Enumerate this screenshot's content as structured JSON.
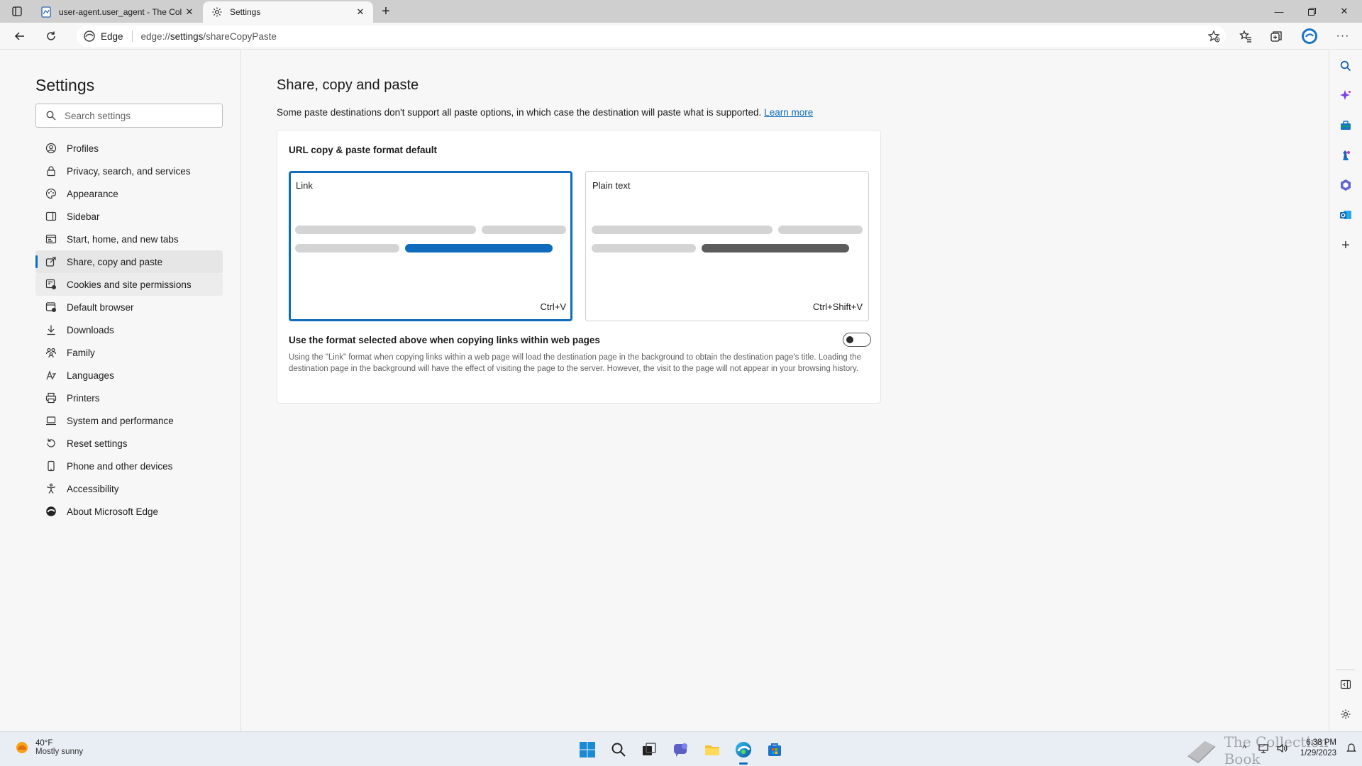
{
  "browser": {
    "tabs": [
      {
        "title": "user-agent.user_agent - The Coll",
        "icon": "document-icon"
      },
      {
        "title": "Settings",
        "icon": "gear-icon"
      }
    ],
    "address": {
      "site_label": "Edge",
      "url_prefix": "edge://",
      "url_host": "settings",
      "url_path": "/shareCopyPaste"
    }
  },
  "sidebar": {
    "title": "Settings",
    "search_placeholder": "Search settings",
    "items": [
      {
        "label": "Profiles",
        "icon": "profile-icon"
      },
      {
        "label": "Privacy, search, and services",
        "icon": "lock-icon"
      },
      {
        "label": "Appearance",
        "icon": "palette-icon"
      },
      {
        "label": "Sidebar",
        "icon": "sidebar-icon"
      },
      {
        "label": "Start, home, and new tabs",
        "icon": "home-icon"
      },
      {
        "label": "Share, copy and paste",
        "icon": "share-icon"
      },
      {
        "label": "Cookies and site permissions",
        "icon": "cookie-icon"
      },
      {
        "label": "Default browser",
        "icon": "browser-icon"
      },
      {
        "label": "Downloads",
        "icon": "download-icon"
      },
      {
        "label": "Family",
        "icon": "family-icon"
      },
      {
        "label": "Languages",
        "icon": "language-icon"
      },
      {
        "label": "Printers",
        "icon": "printer-icon"
      },
      {
        "label": "System and performance",
        "icon": "laptop-icon"
      },
      {
        "label": "Reset settings",
        "icon": "reset-icon"
      },
      {
        "label": "Phone and other devices",
        "icon": "phone-icon"
      },
      {
        "label": "Accessibility",
        "icon": "accessibility-icon"
      },
      {
        "label": "About Microsoft Edge",
        "icon": "edge-icon"
      }
    ],
    "active_index": 5
  },
  "main": {
    "title": "Share, copy and paste",
    "description": "Some paste destinations don't support all paste options, in which case the destination will paste what is supported.",
    "learn_more": "Learn more",
    "card": {
      "title": "URL copy & paste format default",
      "options": [
        {
          "label": "Link",
          "shortcut": "Ctrl+V",
          "selected": true,
          "accent": "#0f6cbd"
        },
        {
          "label": "Plain text",
          "shortcut": "Ctrl+Shift+V",
          "selected": false,
          "accent": "#5c5c5c"
        }
      ],
      "toggle_label": "Use the format selected above when copying links within web pages",
      "toggle_on": false,
      "toggle_description": "Using the \"Link\" format when copying links within a web page will load the destination page in the background to obtain the destination page's title. Loading the destination page in the background will have the effect of visiting the page to the server. However, the visit to the page will not appear in your browsing history."
    }
  },
  "taskbar": {
    "weather_temp": "40°F",
    "weather_cond": "Mostly sunny",
    "time": "6:38 PM",
    "date": "1/29/2023",
    "watermark": "The Collection Book"
  },
  "colors": {
    "accent": "#0f6cbd"
  }
}
